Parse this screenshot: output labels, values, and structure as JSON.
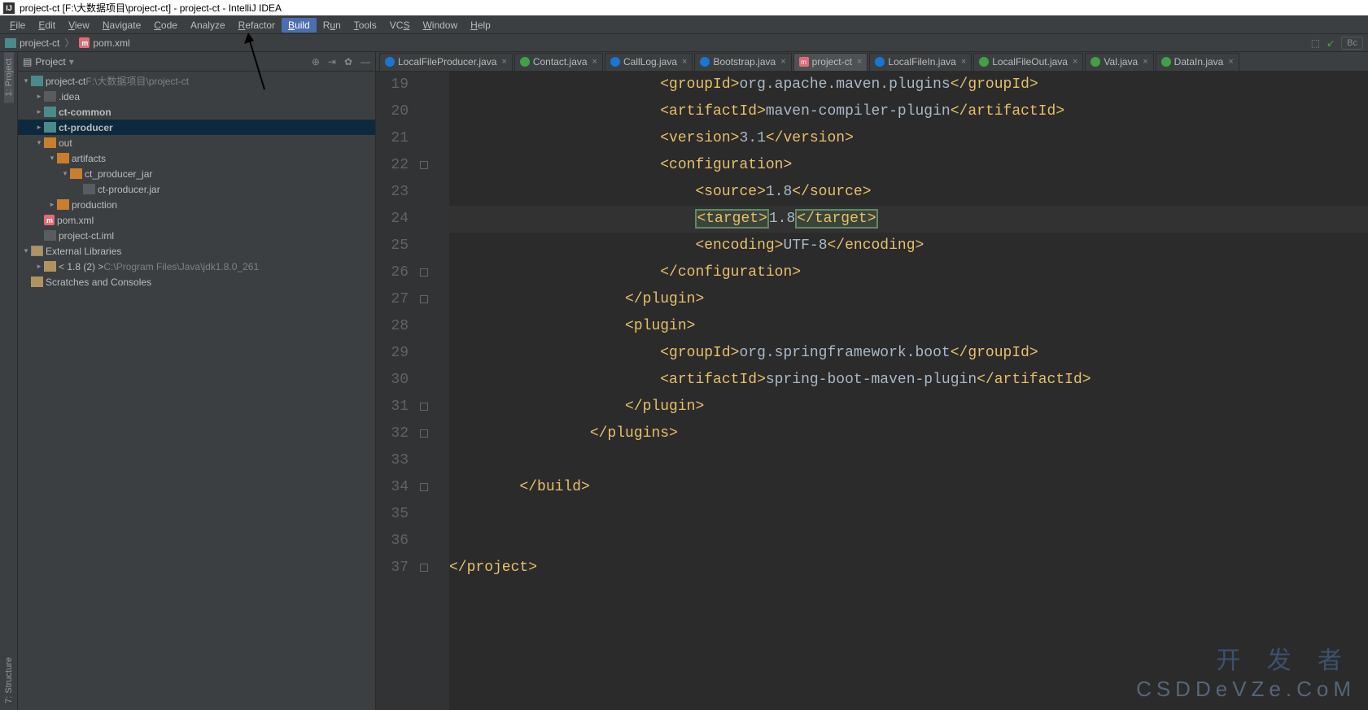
{
  "title": "project-ct [F:\\大数据项目\\project-ct] - project-ct - IntelliJ IDEA",
  "menu": [
    "File",
    "Edit",
    "View",
    "Navigate",
    "Code",
    "Analyze",
    "Refactor",
    "Build",
    "Run",
    "Tools",
    "VCS",
    "Window",
    "Help"
  ],
  "menu_underline_idx": [
    0,
    0,
    0,
    0,
    0,
    null,
    0,
    0,
    1,
    0,
    2,
    0,
    0
  ],
  "menu_highlight": "Build",
  "breadcrumb": {
    "project": "project-ct",
    "file": "pom.xml"
  },
  "right_buttons": {
    "bc": "Bc"
  },
  "sidebar": {
    "title": "Project",
    "tree": [
      {
        "d": 0,
        "arr": "exp",
        "icon": "folder-t",
        "label": "project-ct",
        "path": " F:\\大数据项目\\project-ct"
      },
      {
        "d": 1,
        "arr": "col",
        "icon": "folder-dk",
        "label": ".idea"
      },
      {
        "d": 1,
        "arr": "col",
        "icon": "folder-t",
        "label": "ct-common",
        "bold": true
      },
      {
        "d": 1,
        "arr": "col",
        "icon": "folder-t",
        "label": "ct-producer",
        "sel": true,
        "bold": true
      },
      {
        "d": 1,
        "arr": "exp",
        "icon": "folder-o",
        "label": "out"
      },
      {
        "d": 2,
        "arr": "exp",
        "icon": "folder-o",
        "label": "artifacts"
      },
      {
        "d": 3,
        "arr": "exp",
        "icon": "folder-o",
        "label": "ct_producer_jar"
      },
      {
        "d": 4,
        "arr": "",
        "icon": "file",
        "label": "ct-producer.jar"
      },
      {
        "d": 2,
        "arr": "col",
        "icon": "folder-o",
        "label": "production"
      },
      {
        "d": 1,
        "arr": "",
        "icon": "m",
        "label": "pom.xml"
      },
      {
        "d": 1,
        "arr": "",
        "icon": "file",
        "label": "project-ct.iml"
      },
      {
        "d": 0,
        "arr": "exp",
        "icon": "lib",
        "label": "External Libraries"
      },
      {
        "d": 1,
        "arr": "col",
        "icon": "folder-y",
        "label": "< 1.8 (2) >",
        "path": " C:\\Program Files\\Java\\jdk1.8.0_261"
      },
      {
        "d": 0,
        "arr": "",
        "icon": "scr",
        "label": "Scratches and Consoles"
      }
    ]
  },
  "leftbar": {
    "project": "1: Project",
    "structure": "7: Structure"
  },
  "tabs": [
    {
      "label": "LocalFileProducer.java",
      "icon": "c-blue"
    },
    {
      "label": "Contact.java",
      "icon": "c-green"
    },
    {
      "label": "CallLog.java",
      "icon": "c-blue"
    },
    {
      "label": "Bootstrap.java",
      "icon": "c-blue"
    },
    {
      "label": "project-ct",
      "icon": "c-m",
      "active": true
    },
    {
      "label": "LocalFileIn.java",
      "icon": "c-blue"
    },
    {
      "label": "LocalFileOut.java",
      "icon": "c-green"
    },
    {
      "label": "Val.java",
      "icon": "c-green"
    },
    {
      "label": "DataIn.java",
      "icon": "c-green"
    }
  ],
  "code_start_line": 19,
  "code_lines": [
    {
      "ind": 12,
      "tokens": [
        {
          "t": "<groupId>",
          "c": "tag"
        },
        {
          "t": "org.apache.maven.plugins",
          "c": "text"
        },
        {
          "t": "</groupId>",
          "c": "tag"
        }
      ]
    },
    {
      "ind": 12,
      "tokens": [
        {
          "t": "<artifactId>",
          "c": "tag"
        },
        {
          "t": "maven-compiler-plugin",
          "c": "text"
        },
        {
          "t": "</artifactId>",
          "c": "tag"
        }
      ]
    },
    {
      "ind": 12,
      "tokens": [
        {
          "t": "<version>",
          "c": "tag"
        },
        {
          "t": "3.1",
          "c": "text"
        },
        {
          "t": "</version>",
          "c": "tag"
        }
      ]
    },
    {
      "ind": 12,
      "tokens": [
        {
          "t": "<configuration>",
          "c": "tag"
        }
      ]
    },
    {
      "ind": 14,
      "tokens": [
        {
          "t": "<source>",
          "c": "tag"
        },
        {
          "t": "1.8",
          "c": "text"
        },
        {
          "t": "</source>",
          "c": "tag"
        }
      ]
    },
    {
      "ind": 14,
      "hl": true,
      "tokens": [
        {
          "t": "<target>",
          "c": "tag",
          "box": true
        },
        {
          "t": "1.8",
          "c": "text"
        },
        {
          "t": "</target>",
          "c": "tag",
          "box": true
        }
      ]
    },
    {
      "ind": 14,
      "tokens": [
        {
          "t": "<encoding>",
          "c": "tag"
        },
        {
          "t": "UTF-8",
          "c": "text"
        },
        {
          "t": "</encoding>",
          "c": "tag"
        }
      ]
    },
    {
      "ind": 12,
      "tokens": [
        {
          "t": "</configuration>",
          "c": "tag"
        }
      ]
    },
    {
      "ind": 10,
      "tokens": [
        {
          "t": "</plugin>",
          "c": "tag"
        }
      ]
    },
    {
      "ind": 10,
      "tokens": [
        {
          "t": "<plugin>",
          "c": "tag"
        }
      ]
    },
    {
      "ind": 12,
      "tokens": [
        {
          "t": "<groupId>",
          "c": "tag"
        },
        {
          "t": "org.springframework.boot",
          "c": "text"
        },
        {
          "t": "</groupId>",
          "c": "tag"
        }
      ]
    },
    {
      "ind": 12,
      "tokens": [
        {
          "t": "<artifactId>",
          "c": "tag"
        },
        {
          "t": "spring-boot-maven-plugin",
          "c": "text"
        },
        {
          "t": "</artifactId>",
          "c": "tag"
        }
      ]
    },
    {
      "ind": 10,
      "tokens": [
        {
          "t": "</plugin>",
          "c": "tag"
        }
      ]
    },
    {
      "ind": 8,
      "tokens": [
        {
          "t": "</plugins>",
          "c": "tag"
        }
      ]
    },
    {
      "ind": 0,
      "tokens": []
    },
    {
      "ind": 4,
      "tokens": [
        {
          "t": "</build>",
          "c": "tag"
        }
      ]
    },
    {
      "ind": 0,
      "tokens": []
    },
    {
      "ind": 0,
      "tokens": []
    },
    {
      "ind": 0,
      "tokens": [
        {
          "t": "</project>",
          "c": "tag"
        }
      ]
    }
  ],
  "fold_end_rows": [
    4,
    8,
    9,
    13,
    14,
    16,
    19
  ],
  "watermark_top": "开 发 者",
  "watermark_bottom": "CSDDeVZe.CoM"
}
